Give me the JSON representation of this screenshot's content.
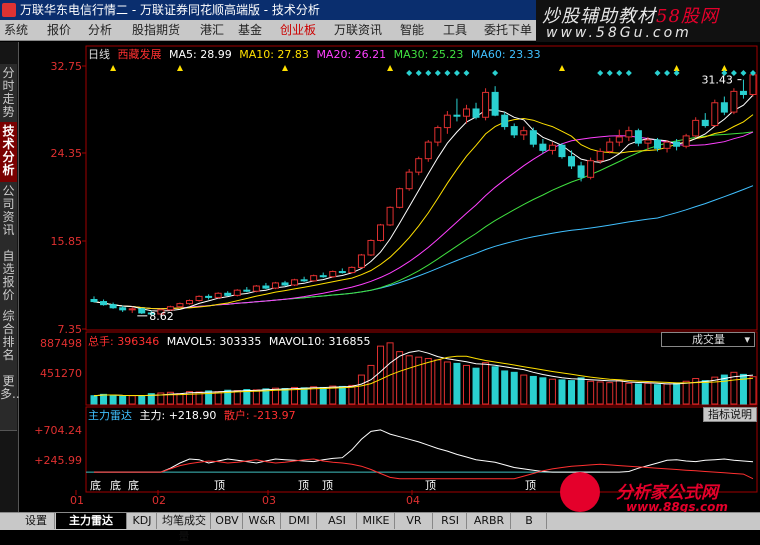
{
  "window": {
    "title": "万联华东电信行情二 - 万联证券同花顺高端版 - 技术分析"
  },
  "menu": [
    {
      "label": "系统",
      "active": false
    },
    {
      "label": "报价",
      "active": false
    },
    {
      "label": "分析",
      "active": false
    },
    {
      "label": "股指期货",
      "active": false
    },
    {
      "label": "港汇",
      "active": false
    },
    {
      "label": "基金",
      "active": false
    },
    {
      "label": "创业板",
      "active": true
    },
    {
      "label": "万联资讯",
      "active": false
    },
    {
      "label": "智能",
      "active": false
    },
    {
      "label": "工具",
      "active": false
    },
    {
      "label": "委托下单",
      "active": false
    }
  ],
  "watermark": {
    "line1_a": "炒股辅助教材",
    "line1_b": "58股网",
    "line2": "www.58Gu.com"
  },
  "sidebar": {
    "tabs": [
      {
        "label": "分时走势",
        "active": false
      },
      {
        "label": "技术分析",
        "active": true
      },
      {
        "label": "公司资讯",
        "active": false
      },
      {
        "label": "自选报价",
        "active": false
      },
      {
        "label": "综合排名",
        "active": false
      },
      {
        "label": "更多..",
        "active": false
      }
    ]
  },
  "main_info": {
    "period": "日线",
    "stock": "西藏发展",
    "ma5": "MA5: 28.99",
    "ma10": "MA10: 27.83",
    "ma20": "MA20: 26.21",
    "ma30": "MA30: 25.23",
    "ma60": "MA60: 23.33"
  },
  "price_axis": [
    "32.75",
    "24.35",
    "15.85",
    "7.35"
  ],
  "price_labels": {
    "low": "8.62",
    "high": "31.43"
  },
  "volume_info": {
    "total": "总手: 396346",
    "mavol5": "MAVOL5: 303335",
    "mavol10": "MAVOL10: 316855",
    "dropdown": "成交量"
  },
  "volume_axis": [
    "887498",
    "451270"
  ],
  "indicator_info": {
    "name": "主力雷达",
    "main": "主力: +218.90",
    "retail": "散户: -213.97",
    "button": "指标说明"
  },
  "indicator_axis": [
    "+704.24",
    "+245.99"
  ],
  "indicator_marks": [
    "底",
    "底",
    "底",
    "顶",
    "顶",
    "顶",
    "顶",
    "顶"
  ],
  "date_axis": [
    "01",
    "02",
    "03",
    "04"
  ],
  "bottom_tabs": [
    {
      "label": "设置",
      "active": false
    },
    {
      "label": "主力雷达",
      "active": true
    },
    {
      "label": "KDJ",
      "active": false
    },
    {
      "label": "均笔成交量",
      "active": false
    },
    {
      "label": "OBV",
      "active": false
    },
    {
      "label": "W&R",
      "active": false
    },
    {
      "label": "DMI",
      "active": false
    },
    {
      "label": "ASI",
      "active": false
    },
    {
      "label": "MIKE",
      "active": false
    },
    {
      "label": "VR",
      "active": false
    },
    {
      "label": "RSI",
      "active": false
    },
    {
      "label": "ARBR",
      "active": false
    },
    {
      "label": "B",
      "active": false
    }
  ],
  "logo2": {
    "line1": "分析家公式网",
    "line2": "www.88gs.com"
  },
  "colors": {
    "up": "#e03030",
    "down": "#2ad0d0",
    "ma5": "#ffffff",
    "ma10": "#ffe000",
    "ma20": "#ff40ff",
    "ma30": "#40e040",
    "ma60": "#40c0ff",
    "panel_border": "#a00000"
  },
  "chart_data": {
    "type": "candlestick",
    "price_ylim": [
      7.35,
      32.75
    ],
    "candles": [
      {
        "i": 0,
        "o": 10.2,
        "h": 10.5,
        "l": 9.9,
        "c": 10.0
      },
      {
        "i": 1,
        "o": 10.0,
        "h": 10.2,
        "l": 9.6,
        "c": 9.7
      },
      {
        "i": 2,
        "o": 9.7,
        "h": 9.9,
        "l": 9.3,
        "c": 9.4
      },
      {
        "i": 3,
        "o": 9.4,
        "h": 9.6,
        "l": 9.0,
        "c": 9.2
      },
      {
        "i": 4,
        "o": 9.2,
        "h": 9.5,
        "l": 8.9,
        "c": 9.3
      },
      {
        "i": 5,
        "o": 9.3,
        "h": 9.4,
        "l": 8.8,
        "c": 8.9
      },
      {
        "i": 6,
        "o": 8.9,
        "h": 9.1,
        "l": 8.62,
        "c": 8.8
      },
      {
        "i": 7,
        "o": 8.8,
        "h": 9.3,
        "l": 8.7,
        "c": 9.2
      },
      {
        "i": 8,
        "o": 9.2,
        "h": 9.6,
        "l": 9.1,
        "c": 9.5
      },
      {
        "i": 9,
        "o": 9.5,
        "h": 9.9,
        "l": 9.4,
        "c": 9.8
      },
      {
        "i": 10,
        "o": 9.8,
        "h": 10.2,
        "l": 9.7,
        "c": 10.1
      },
      {
        "i": 11,
        "o": 10.1,
        "h": 10.6,
        "l": 10.0,
        "c": 10.5
      },
      {
        "i": 12,
        "o": 10.5,
        "h": 10.7,
        "l": 10.2,
        "c": 10.4
      },
      {
        "i": 13,
        "o": 10.4,
        "h": 10.9,
        "l": 10.3,
        "c": 10.8
      },
      {
        "i": 14,
        "o": 10.8,
        "h": 11.0,
        "l": 10.5,
        "c": 10.6
      },
      {
        "i": 15,
        "o": 10.6,
        "h": 11.2,
        "l": 10.5,
        "c": 11.1
      },
      {
        "i": 16,
        "o": 11.1,
        "h": 11.4,
        "l": 10.9,
        "c": 11.0
      },
      {
        "i": 17,
        "o": 11.0,
        "h": 11.6,
        "l": 10.9,
        "c": 11.5
      },
      {
        "i": 18,
        "o": 11.5,
        "h": 11.8,
        "l": 11.2,
        "c": 11.3
      },
      {
        "i": 19,
        "o": 11.3,
        "h": 11.9,
        "l": 11.2,
        "c": 11.8
      },
      {
        "i": 20,
        "o": 11.8,
        "h": 12.0,
        "l": 11.5,
        "c": 11.6
      },
      {
        "i": 21,
        "o": 11.6,
        "h": 12.2,
        "l": 11.5,
        "c": 12.1
      },
      {
        "i": 22,
        "o": 12.1,
        "h": 12.4,
        "l": 11.9,
        "c": 12.0
      },
      {
        "i": 23,
        "o": 12.0,
        "h": 12.6,
        "l": 11.9,
        "c": 12.5
      },
      {
        "i": 24,
        "o": 12.5,
        "h": 12.8,
        "l": 12.3,
        "c": 12.4
      },
      {
        "i": 25,
        "o": 12.4,
        "h": 13.0,
        "l": 12.3,
        "c": 12.9
      },
      {
        "i": 26,
        "o": 12.9,
        "h": 13.2,
        "l": 12.7,
        "c": 12.8
      },
      {
        "i": 27,
        "o": 12.8,
        "h": 13.4,
        "l": 12.7,
        "c": 13.3
      },
      {
        "i": 28,
        "o": 13.3,
        "h": 14.6,
        "l": 13.2,
        "c": 14.5
      },
      {
        "i": 29,
        "o": 14.5,
        "h": 16.0,
        "l": 14.4,
        "c": 15.9
      },
      {
        "i": 30,
        "o": 15.9,
        "h": 17.5,
        "l": 15.8,
        "c": 17.4
      },
      {
        "i": 31,
        "o": 17.4,
        "h": 19.2,
        "l": 17.3,
        "c": 19.1
      },
      {
        "i": 32,
        "o": 19.1,
        "h": 21.0,
        "l": 19.0,
        "c": 20.9
      },
      {
        "i": 33,
        "o": 20.9,
        "h": 22.8,
        "l": 20.7,
        "c": 22.5
      },
      {
        "i": 34,
        "o": 22.5,
        "h": 24.0,
        "l": 22.2,
        "c": 23.8
      },
      {
        "i": 35,
        "o": 23.8,
        "h": 25.6,
        "l": 23.5,
        "c": 25.4
      },
      {
        "i": 36,
        "o": 25.4,
        "h": 27.0,
        "l": 25.0,
        "c": 26.8
      },
      {
        "i": 37,
        "o": 26.8,
        "h": 28.4,
        "l": 26.2,
        "c": 28.0
      },
      {
        "i": 38,
        "o": 28.0,
        "h": 29.6,
        "l": 27.4,
        "c": 27.9
      },
      {
        "i": 39,
        "o": 27.9,
        "h": 29.0,
        "l": 27.2,
        "c": 28.6
      },
      {
        "i": 40,
        "o": 28.6,
        "h": 29.2,
        "l": 27.6,
        "c": 27.8
      },
      {
        "i": 41,
        "o": 27.8,
        "h": 30.6,
        "l": 27.5,
        "c": 30.2
      },
      {
        "i": 42,
        "o": 30.2,
        "h": 30.8,
        "l": 27.9,
        "c": 28.0
      },
      {
        "i": 43,
        "o": 28.0,
        "h": 28.3,
        "l": 26.6,
        "c": 26.9
      },
      {
        "i": 44,
        "o": 26.9,
        "h": 27.2,
        "l": 25.8,
        "c": 26.1
      },
      {
        "i": 45,
        "o": 26.1,
        "h": 26.9,
        "l": 25.6,
        "c": 26.5
      },
      {
        "i": 46,
        "o": 26.5,
        "h": 26.8,
        "l": 24.9,
        "c": 25.2
      },
      {
        "i": 47,
        "o": 25.2,
        "h": 25.7,
        "l": 24.3,
        "c": 24.6
      },
      {
        "i": 48,
        "o": 24.6,
        "h": 25.4,
        "l": 24.2,
        "c": 25.1
      },
      {
        "i": 49,
        "o": 25.1,
        "h": 25.3,
        "l": 23.8,
        "c": 24.0
      },
      {
        "i": 50,
        "o": 24.0,
        "h": 24.6,
        "l": 22.8,
        "c": 23.1
      },
      {
        "i": 51,
        "o": 23.1,
        "h": 23.5,
        "l": 21.6,
        "c": 22.0
      },
      {
        "i": 52,
        "o": 22.0,
        "h": 23.9,
        "l": 21.8,
        "c": 23.6
      },
      {
        "i": 53,
        "o": 23.6,
        "h": 24.8,
        "l": 23.3,
        "c": 24.5
      },
      {
        "i": 54,
        "o": 24.5,
        "h": 25.8,
        "l": 24.3,
        "c": 25.4
      },
      {
        "i": 55,
        "o": 25.4,
        "h": 26.6,
        "l": 25.0,
        "c": 25.9
      },
      {
        "i": 56,
        "o": 25.9,
        "h": 26.9,
        "l": 25.5,
        "c": 26.5
      },
      {
        "i": 57,
        "o": 26.5,
        "h": 26.7,
        "l": 25.0,
        "c": 25.3
      },
      {
        "i": 58,
        "o": 25.3,
        "h": 25.9,
        "l": 24.6,
        "c": 25.6
      },
      {
        "i": 59,
        "o": 25.6,
        "h": 25.8,
        "l": 24.5,
        "c": 24.8
      },
      {
        "i": 60,
        "o": 24.8,
        "h": 25.6,
        "l": 24.4,
        "c": 25.4
      },
      {
        "i": 61,
        "o": 25.4,
        "h": 25.7,
        "l": 24.6,
        "c": 25.0
      },
      {
        "i": 62,
        "o": 25.0,
        "h": 26.2,
        "l": 24.8,
        "c": 26.0
      },
      {
        "i": 63,
        "o": 26.0,
        "h": 27.8,
        "l": 25.8,
        "c": 27.5
      },
      {
        "i": 64,
        "o": 27.5,
        "h": 28.2,
        "l": 26.8,
        "c": 27.0
      },
      {
        "i": 65,
        "o": 27.0,
        "h": 29.5,
        "l": 26.9,
        "c": 29.2
      },
      {
        "i": 66,
        "o": 29.2,
        "h": 29.8,
        "l": 28.0,
        "c": 28.3
      },
      {
        "i": 67,
        "o": 28.3,
        "h": 30.6,
        "l": 28.1,
        "c": 30.3
      },
      {
        "i": 68,
        "o": 30.3,
        "h": 31.43,
        "l": 29.6,
        "c": 30.0
      },
      {
        "i": 69,
        "o": 30.0,
        "h": 32.2,
        "l": 29.8,
        "c": 31.9
      }
    ],
    "volume_ylim": [
      0,
      900000
    ],
    "volumes": [
      120000,
      140000,
      130000,
      110000,
      120000,
      115000,
      150000,
      160000,
      170000,
      150000,
      180000,
      175000,
      190000,
      180000,
      200000,
      195000,
      210000,
      205000,
      220000,
      230000,
      225000,
      240000,
      235000,
      250000,
      240000,
      260000,
      255000,
      270000,
      420000,
      560000,
      840000,
      887498,
      760000,
      700000,
      680000,
      660000,
      640000,
      610000,
      590000,
      560000,
      520000,
      600000,
      540000,
      480000,
      460000,
      420000,
      400000,
      380000,
      360000,
      350000,
      340000,
      380000,
      330000,
      320000,
      310000,
      340000,
      300000,
      290000,
      300000,
      280000,
      290000,
      300000,
      330000,
      370000,
      340000,
      390000,
      420000,
      460000,
      430000,
      396346
    ],
    "indicator_ylim": [
      -212,
      900
    ],
    "indicator_main": [
      60,
      60,
      60,
      60,
      60,
      60,
      60,
      60,
      120,
      200,
      260,
      250,
      200,
      230,
      260,
      240,
      220,
      200,
      230,
      260,
      250,
      240,
      230,
      220,
      250,
      270,
      280,
      400,
      560,
      680,
      704.24,
      640,
      600,
      560,
      520,
      470,
      420,
      380,
      330,
      290,
      250,
      230,
      210,
      170,
      130,
      110,
      90,
      70,
      60,
      60,
      60,
      60,
      60,
      60,
      60,
      60,
      70,
      120,
      160,
      200,
      240,
      250,
      230,
      220,
      240,
      250,
      260,
      240,
      230,
      218.9
    ],
    "indicator_retail": [
      60,
      60,
      60,
      60,
      60,
      60,
      60,
      60,
      110,
      160,
      190,
      210,
      230,
      220,
      200,
      210,
      230,
      250,
      220,
      200,
      210,
      230,
      250,
      260,
      230,
      210,
      200,
      180,
      150,
      100,
      40,
      -20,
      -60,
      -90,
      -120,
      -150,
      -170,
      -190,
      -200,
      -212,
      -190,
      -160,
      -120,
      -80,
      -40,
      0,
      40,
      80,
      110,
      130,
      150,
      160,
      170,
      180,
      170,
      160,
      150,
      140,
      130,
      120,
      110,
      100,
      90,
      80,
      70,
      60,
      50,
      40,
      30,
      -213.97
    ]
  }
}
